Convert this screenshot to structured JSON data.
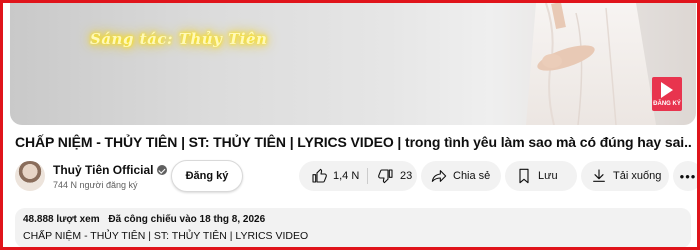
{
  "video": {
    "overlay_text": "Sáng tác: Thủy Tiên",
    "watermark_label": "ĐĂNG KÝ",
    "watermark_color": "#e8344e"
  },
  "title": "CHẤP NIỆM - THỦY TIÊN | ST: THỦY TIÊN | LYRICS VIDEO | trong tình yêu làm sao mà có đúng hay sai...",
  "channel": {
    "name": "Thuỷ Tiên Official",
    "subscribers": "744 N người đăng ký",
    "subscribe_label": "Đăng ký",
    "verified_icon": "verified-check-icon"
  },
  "actions": {
    "likes": "1,4 N",
    "dislikes": "23",
    "share_label": "Chia sẻ",
    "save_label": "Lưu",
    "download_label": "Tải xuống",
    "more_label": "•••"
  },
  "description": {
    "views": "48.888 lượt xem",
    "premiere": "Đã công chiếu vào 18 thg 8, 2026",
    "text": "CHẤP NIỆM - THỦY TIÊN | ST: THỦY TIÊN | LYRICS VIDEO"
  },
  "colors": {
    "frame_border": "#e0141b",
    "pill_bg": "#f2f2f2",
    "neon": "#ffe800"
  }
}
